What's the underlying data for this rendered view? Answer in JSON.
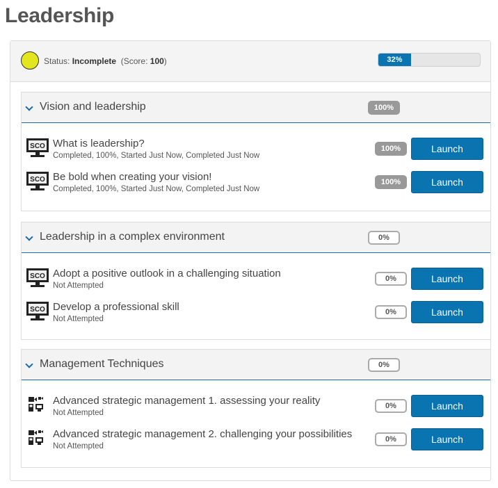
{
  "page": {
    "title": "Leadership"
  },
  "status": {
    "label": "Status:",
    "value": "Incomplete",
    "score_prefix": "(Score:",
    "score": "100",
    "score_suffix": ")",
    "progress_text": "32%",
    "progress_value": 0.32,
    "indicator_color": "#e3e61e"
  },
  "colors": {
    "accent": "#0a74b0",
    "badge_full": "#999999"
  },
  "launch_label": "Launch",
  "sections": [
    {
      "title": "Vision and leadership",
      "percent": "100%",
      "items": [
        {
          "title": "What is leadership?",
          "subtitle": "Completed, 100%, Started Just Now, Completed Just Now",
          "percent": "100%",
          "icon": "sco-monitor-icon"
        },
        {
          "title": "Be bold when creating your vision!",
          "subtitle": "Completed, 100%, Started Just Now, Completed Just Now",
          "percent": "100%",
          "icon": "sco-monitor-icon"
        }
      ]
    },
    {
      "title": "Leadership in a complex environment",
      "percent": "0%",
      "items": [
        {
          "title": "Adopt a positive outlook in a challenging situation",
          "subtitle": "Not Attempted",
          "percent": "0%",
          "icon": "sco-monitor-icon"
        },
        {
          "title": "Develop a professional skill",
          "subtitle": "Not Attempted",
          "percent": "0%",
          "icon": "sco-monitor-icon"
        }
      ]
    },
    {
      "title": "Management Techniques",
      "percent": "0%",
      "items": [
        {
          "title": "Advanced strategic management 1. assessing your reality",
          "subtitle": "Not Attempted",
          "percent": "0%",
          "icon": "multimedia-icon"
        },
        {
          "title": "Advanced strategic management 2. challenging your possibilities",
          "subtitle": "Not Attempted",
          "percent": "0%",
          "icon": "multimedia-icon"
        }
      ]
    }
  ]
}
